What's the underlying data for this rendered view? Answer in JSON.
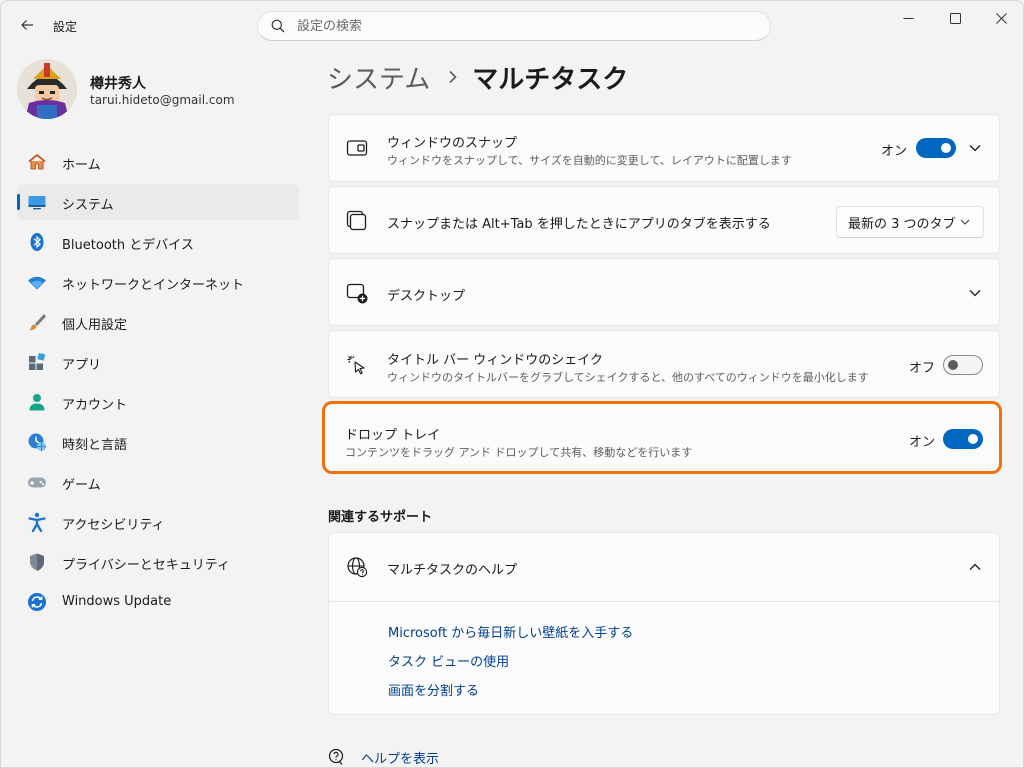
{
  "window": {
    "title": "設定",
    "back_label": "戻る"
  },
  "search": {
    "placeholder": "設定の検索"
  },
  "user": {
    "name": "樽井秀人",
    "email": "tarui.hideto@gmail.com"
  },
  "sidebar": {
    "items": [
      {
        "label": "ホーム",
        "icon": "home-icon"
      },
      {
        "label": "システム",
        "icon": "system-icon",
        "active": true
      },
      {
        "label": "Bluetooth とデバイス",
        "icon": "bluetooth-icon"
      },
      {
        "label": "ネットワークとインターネット",
        "icon": "wifi-icon"
      },
      {
        "label": "個人用設定",
        "icon": "brush-icon"
      },
      {
        "label": "アプリ",
        "icon": "apps-icon"
      },
      {
        "label": "アカウント",
        "icon": "account-icon"
      },
      {
        "label": "時刻と言語",
        "icon": "time-language-icon"
      },
      {
        "label": "ゲーム",
        "icon": "gamepad-icon"
      },
      {
        "label": "アクセシビリティ",
        "icon": "accessibility-icon"
      },
      {
        "label": "プライバシーとセキュリティ",
        "icon": "shield-icon"
      },
      {
        "label": "Windows Update",
        "icon": "windows-update-icon"
      }
    ]
  },
  "breadcrumb": {
    "parent": "システム",
    "current": "マルチタスク"
  },
  "settings": {
    "snap": {
      "title": "ウィンドウのスナップ",
      "subtitle": "ウィンドウをスナップして、サイズを自動的に変更して、レイアウトに配置します",
      "state": "オン",
      "on": true
    },
    "snap_tabs": {
      "title": "スナップまたは Alt+Tab を押したときにアプリのタブを表示する",
      "selected": "最新の 3 つのタブ"
    },
    "desktops": {
      "title": "デスクトップ"
    },
    "shake": {
      "title": "タイトル バー ウィンドウのシェイク",
      "subtitle": "ウィンドウのタイトルバーをグラブしてシェイクすると、他のすべてのウィンドウを最小化します",
      "state": "オフ",
      "on": false
    },
    "drop_tray": {
      "title": "ドロップ トレイ",
      "subtitle": "コンテンツをドラッグ アンド ドロップして共有、移動などを行います",
      "state": "オン",
      "on": true
    }
  },
  "support": {
    "section_title": "関連するサポート",
    "help_title": "マルチタスクのヘルプ",
    "links": [
      "Microsoft から毎日新しい壁紙を入手する",
      "タスク ビューの使用",
      "画面を分割する"
    ]
  },
  "footer": {
    "help_label": "ヘルプを表示"
  },
  "colors": {
    "accent": "#0067c0",
    "highlight": "#f07010",
    "link": "#003e92"
  }
}
